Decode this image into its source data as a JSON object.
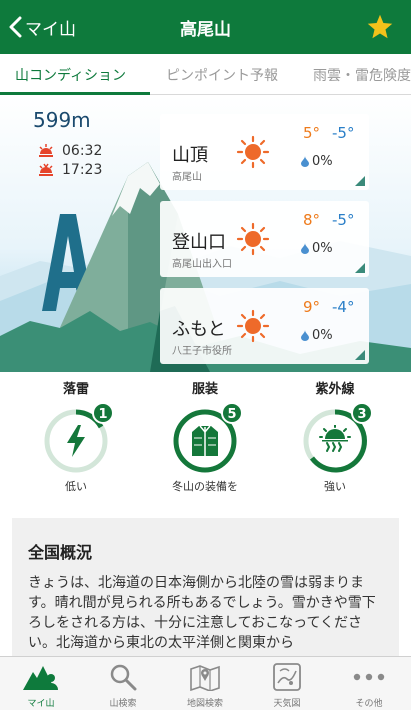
{
  "header": {
    "back_label": "マイ山",
    "title": "高尾山",
    "favorite_icon": "star-icon",
    "bg_color": "#0e7a3c",
    "star_color": "#f2c21b"
  },
  "tabs": [
    {
      "label": "山コンディション",
      "active": true
    },
    {
      "label": "ピンポイント予報",
      "active": false
    },
    {
      "label": "雨雲・雷危険度",
      "active": false
    }
  ],
  "summit": {
    "elevation": "599m",
    "sunrise": "06:32",
    "sunset": "17:23"
  },
  "cards": [
    {
      "name": "山頂",
      "sub": "高尾山",
      "high": "5°",
      "low": "-5°",
      "precip": "0%"
    },
    {
      "name": "登山口",
      "sub": "高尾山出入口",
      "high": "8°",
      "low": "-5°",
      "precip": "0%"
    },
    {
      "name": "ふもと",
      "sub": "八王子市役所",
      "high": "9°",
      "low": "-4°",
      "precip": "0%"
    }
  ],
  "gauges": [
    {
      "title": "落雷",
      "level": "1",
      "label": "低い",
      "icon": "lightning-icon"
    },
    {
      "title": "服装",
      "level": "5",
      "label": "冬山の装備を",
      "icon": "jacket-icon"
    },
    {
      "title": "紫外線",
      "level": "3",
      "label": "強い",
      "icon": "uv-sun-icon"
    }
  ],
  "overview": {
    "title": "全国概況",
    "text": "きょうは、北海道の日本海側から北陸の雪は弱まります。晴れ間が見られる所もあるでしょう。雪かきや雪下ろしをされる方は、十分に注意しておこなってください。北海道から東北の太平洋側と関東から"
  },
  "bottom_nav": [
    {
      "label": "マイ山",
      "icon": "my-mountain-icon",
      "active": true
    },
    {
      "label": "山検索",
      "icon": "search-icon",
      "active": false
    },
    {
      "label": "地図検索",
      "icon": "map-icon",
      "active": false
    },
    {
      "label": "天気図",
      "icon": "weather-map-icon",
      "active": false
    },
    {
      "label": "その他",
      "icon": "more-icon",
      "active": false
    }
  ]
}
